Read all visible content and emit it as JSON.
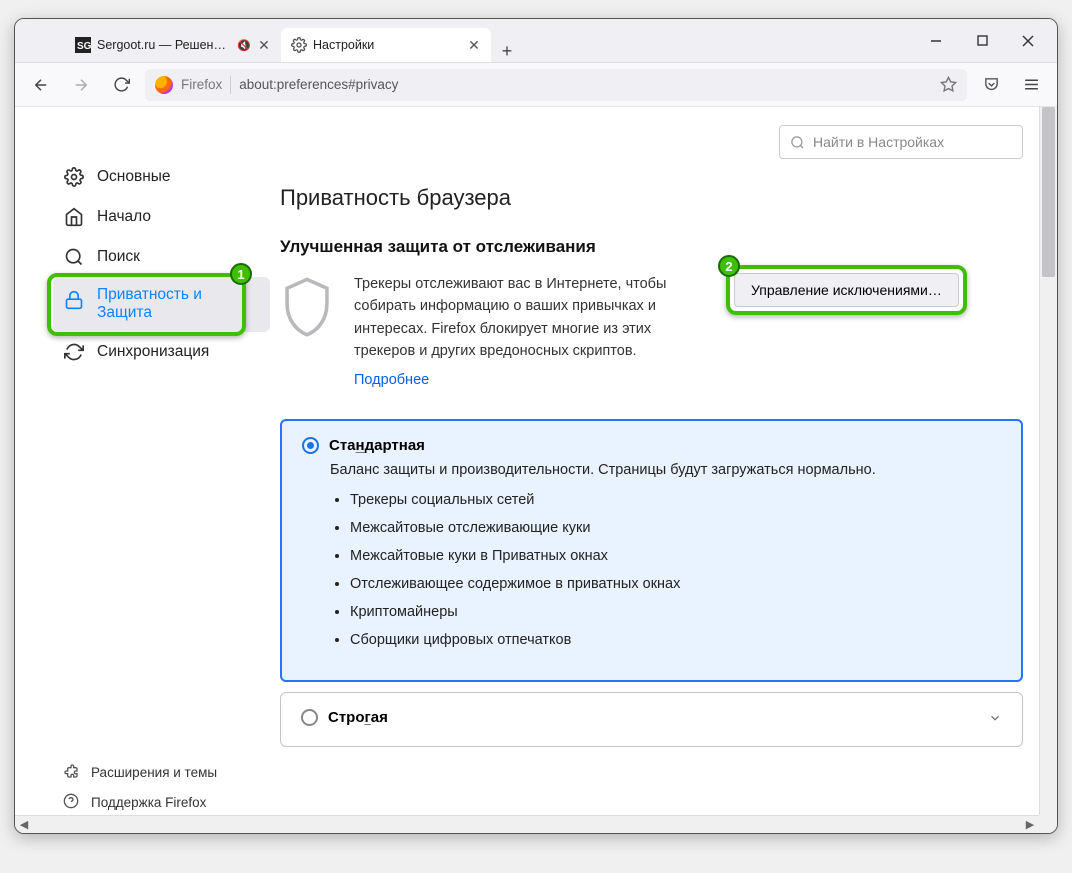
{
  "tabs": {
    "0": {
      "title": "Sergoot.ru — Решение ваших"
    },
    "1": {
      "title": "Настройки"
    }
  },
  "url": {
    "label": "Firefox",
    "text": "about:preferences#privacy"
  },
  "search": {
    "placeholder": "Найти в Настройках"
  },
  "sidebar": {
    "general": "Основные",
    "home": "Начало",
    "search": "Поиск",
    "privacy_line1": "Приватность и",
    "privacy_line2": "Защита",
    "sync": "Синхронизация",
    "ext": "Расширения и темы",
    "help": "Поддержка Firefox"
  },
  "badge1": "1",
  "badge2": "2",
  "page": {
    "h1": "Приватность браузера",
    "h2": "Улучшенная защита от отслеживания",
    "desc": "Трекеры отслеживают вас в Интернете, чтобы собирать информацию о ваших привычках и интересах. Firefox блокирует многие из этих трекеров и других вредоносных скриптов.",
    "learn_more": "Подробнее",
    "exceptions_btn": "Управление исключениями…",
    "standard": {
      "title_pre": "Ста",
      "title_u": "н",
      "title_post": "дартная",
      "desc": "Баланс защиты и производительности. Страницы будут загружаться нормально.",
      "items": [
        "Трекеры социальных сетей",
        "Межсайтовые отслеживающие куки",
        "Межсайтовые куки в Приватных окнах",
        "Отслеживающее содержимое в приватных окнах",
        "Криптомайнеры",
        "Сборщики цифровых отпечатков"
      ]
    },
    "strict": {
      "title_pre": "Стро",
      "title_u": "г",
      "title_post": "ая"
    }
  }
}
